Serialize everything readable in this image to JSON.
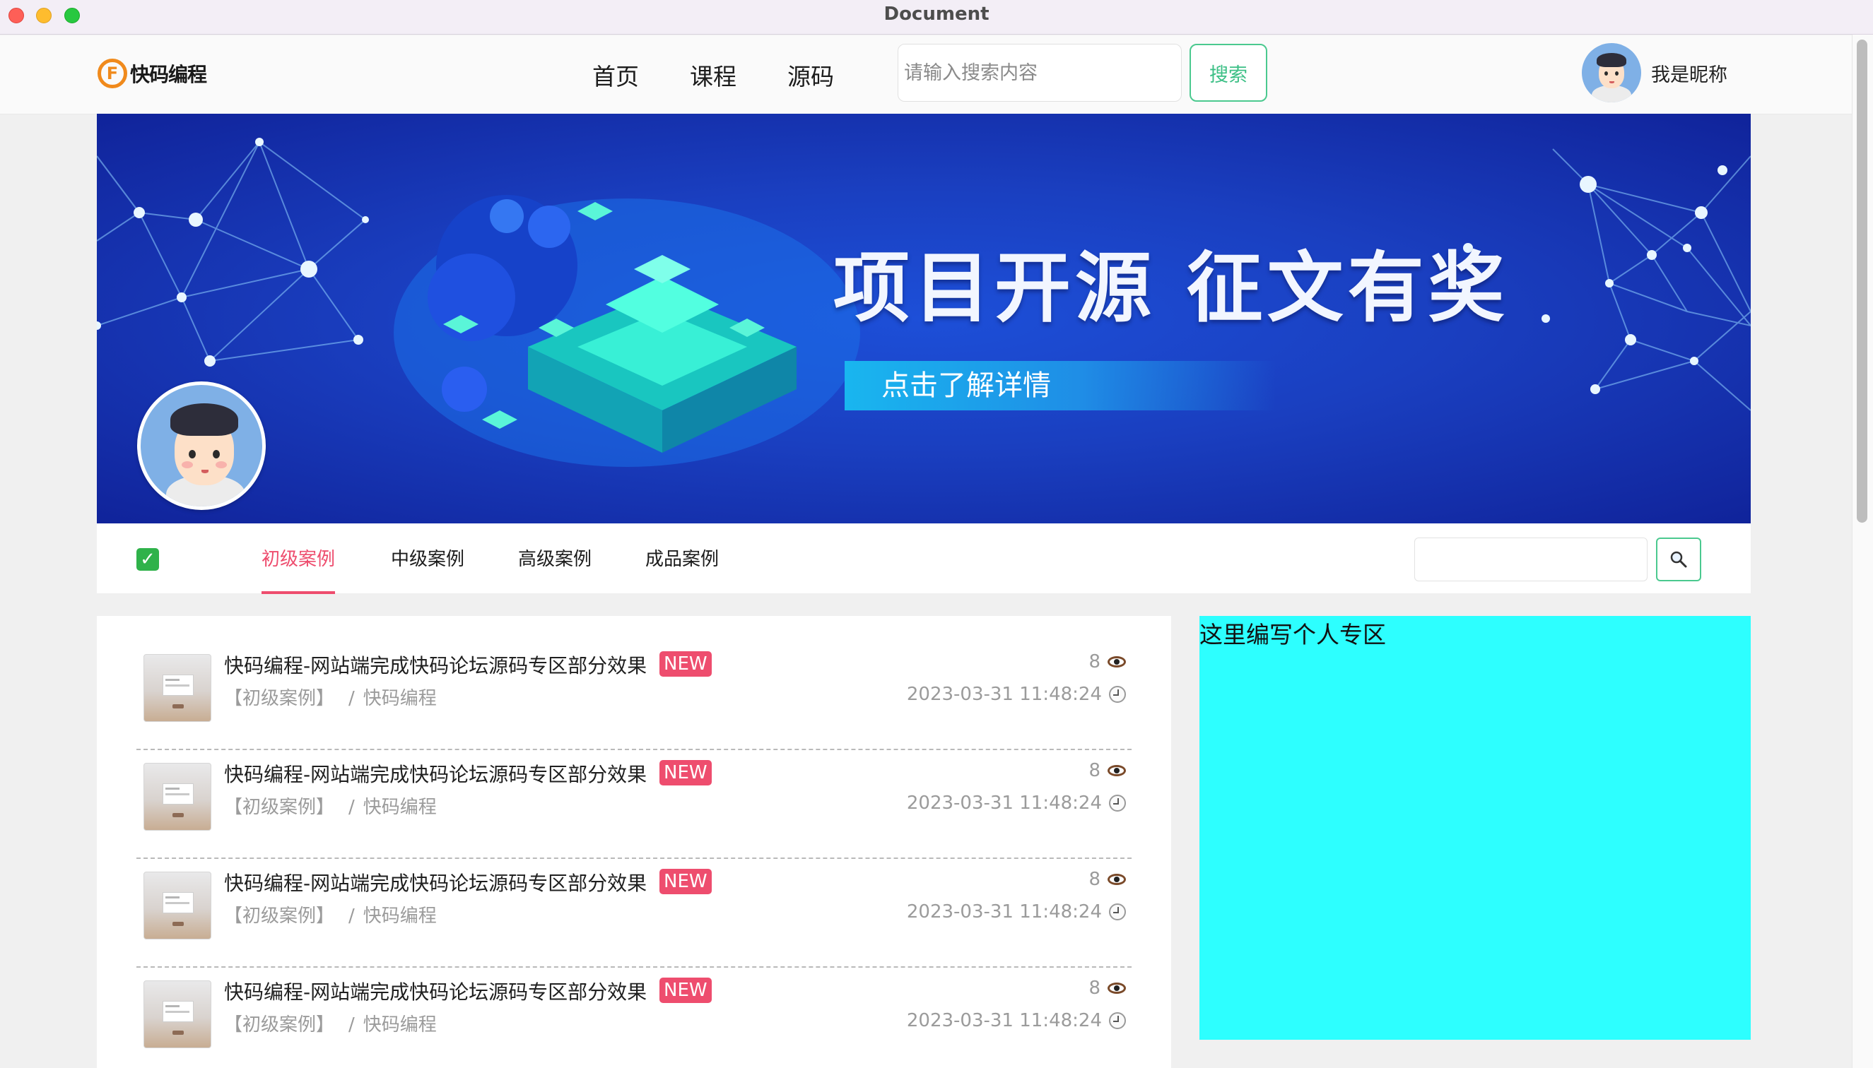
{
  "window": {
    "title": "Document"
  },
  "header": {
    "logo_mark": "F",
    "logo_text": "快码编程",
    "nav": [
      "首页",
      "课程",
      "源码"
    ],
    "search": {
      "placeholder": "请输入搜索内容",
      "button": "搜索"
    },
    "user_name": "我是昵称"
  },
  "banner": {
    "headline": "项目开源  征文有奖",
    "cta": "点击了解详情"
  },
  "category_bar": {
    "tabs": [
      "初级案例",
      "中级案例",
      "高级案例",
      "成品案例"
    ],
    "active_tab": "初级案例",
    "search_icon": "magnifier-icon"
  },
  "articles": [
    {
      "title": "快码编程-网站端完成快码论坛源码专区部分效果",
      "badge": "NEW",
      "category": "【初级案例】",
      "sep": "/",
      "author": "快码编程",
      "views": "8",
      "date": "2023-03-31 11:48:24"
    },
    {
      "title": "快码编程-网站端完成快码论坛源码专区部分效果",
      "badge": "NEW",
      "category": "【初级案例】",
      "sep": "/",
      "author": "快码编程",
      "views": "8",
      "date": "2023-03-31 11:48:24"
    },
    {
      "title": "快码编程-网站端完成快码论坛源码专区部分效果",
      "badge": "NEW",
      "category": "【初级案例】",
      "sep": "/",
      "author": "快码编程",
      "views": "8",
      "date": "2023-03-31 11:48:24"
    },
    {
      "title": "快码编程-网站端完成快码论坛源码专区部分效果",
      "badge": "NEW",
      "category": "【初级案例】",
      "sep": "/",
      "author": "快码编程",
      "views": "8",
      "date": "2023-03-31 11:48:24"
    }
  ],
  "personal_zone": {
    "text": "这里编写个人专区"
  },
  "colors": {
    "accent_green": "#4bc98f",
    "accent_pink": "#ee4d6e",
    "zone_cyan": "#2dffff"
  }
}
